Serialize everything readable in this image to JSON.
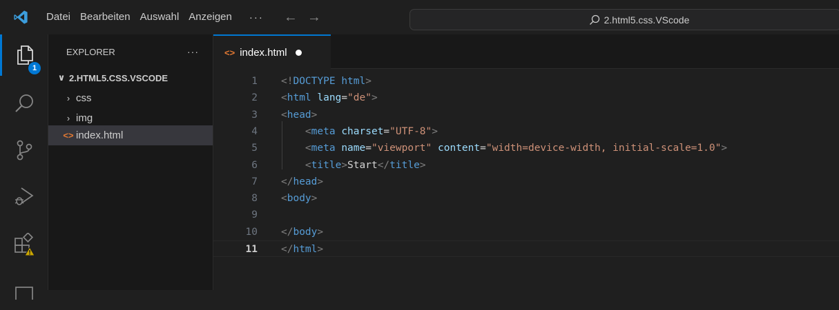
{
  "menu": {
    "items": [
      "Datei",
      "Bearbeiten",
      "Auswahl",
      "Anzeigen"
    ],
    "more": "···"
  },
  "command_center": {
    "text": "2.html5.css.VScode",
    "icon": "search-icon"
  },
  "activity_bar": {
    "explorer_badge": "1",
    "items": [
      "files-icon",
      "search-icon",
      "source-control-icon",
      "run-debug-icon",
      "extensions-icon"
    ]
  },
  "sidebar": {
    "title": "EXPLORER",
    "more": "···",
    "folder": "2.HTML5.CSS.VSCODE",
    "items": [
      {
        "label": "css",
        "type": "folder"
      },
      {
        "label": "img",
        "type": "folder"
      },
      {
        "label": "index.html",
        "type": "file"
      }
    ]
  },
  "tab": {
    "label": "index.html",
    "modified": true
  },
  "editor": {
    "current_line": 11,
    "lines": [
      {
        "n": "1",
        "tokens": [
          [
            "p",
            "<!"
          ],
          [
            "t",
            "DOCTYPE"
          ],
          [
            "txt",
            " "
          ],
          [
            "t",
            "html"
          ],
          [
            "p",
            ">"
          ]
        ]
      },
      {
        "n": "2",
        "tokens": [
          [
            "p",
            "<"
          ],
          [
            "t",
            "html"
          ],
          [
            "txt",
            " "
          ],
          [
            "a",
            "lang"
          ],
          [
            "txt",
            "="
          ],
          [
            "s",
            "\"de\""
          ],
          [
            "p",
            ">"
          ]
        ]
      },
      {
        "n": "3",
        "tokens": [
          [
            "p",
            "<"
          ],
          [
            "t",
            "head"
          ],
          [
            "p",
            ">"
          ]
        ]
      },
      {
        "n": "4",
        "tokens": [
          [
            "txt",
            "    "
          ],
          [
            "p",
            "<"
          ],
          [
            "t",
            "meta"
          ],
          [
            "txt",
            " "
          ],
          [
            "a",
            "charset"
          ],
          [
            "txt",
            "="
          ],
          [
            "s",
            "\"UTF-8\""
          ],
          [
            "p",
            ">"
          ]
        ]
      },
      {
        "n": "5",
        "tokens": [
          [
            "txt",
            "    "
          ],
          [
            "p",
            "<"
          ],
          [
            "t",
            "meta"
          ],
          [
            "txt",
            " "
          ],
          [
            "a",
            "name"
          ],
          [
            "txt",
            "="
          ],
          [
            "s",
            "\"viewport\""
          ],
          [
            "txt",
            " "
          ],
          [
            "a",
            "content"
          ],
          [
            "txt",
            "="
          ],
          [
            "s",
            "\"width=device-width, initial-scale=1.0\""
          ],
          [
            "p",
            ">"
          ]
        ]
      },
      {
        "n": "6",
        "tokens": [
          [
            "txt",
            "    "
          ],
          [
            "p",
            "<"
          ],
          [
            "t",
            "title"
          ],
          [
            "p",
            ">"
          ],
          [
            "txt",
            "Start"
          ],
          [
            "p",
            "</"
          ],
          [
            "t",
            "title"
          ],
          [
            "p",
            ">"
          ]
        ]
      },
      {
        "n": "7",
        "tokens": [
          [
            "p",
            "</"
          ],
          [
            "t",
            "head"
          ],
          [
            "p",
            ">"
          ]
        ]
      },
      {
        "n": "8",
        "tokens": [
          [
            "p",
            "<"
          ],
          [
            "t",
            "body"
          ],
          [
            "p",
            ">"
          ]
        ]
      },
      {
        "n": "9",
        "tokens": []
      },
      {
        "n": "10",
        "tokens": [
          [
            "p",
            "</"
          ],
          [
            "t",
            "body"
          ],
          [
            "p",
            ">"
          ]
        ]
      },
      {
        "n": "11",
        "tokens": [
          [
            "p",
            "</"
          ],
          [
            "t",
            "html"
          ],
          [
            "p",
            ">"
          ]
        ]
      }
    ]
  },
  "colors": {
    "accent": "#0078d4",
    "html_file_icon": "#e37933",
    "warning": "#cca700"
  }
}
